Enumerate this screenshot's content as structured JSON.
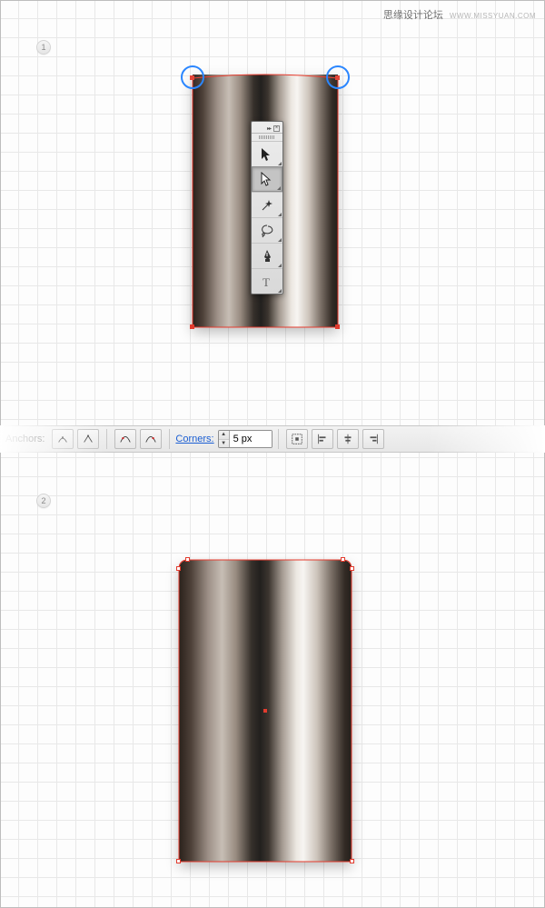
{
  "watermark": {
    "cn": "思缘设计论坛",
    "en": "WWW.MISSYUAN.COM"
  },
  "steps": {
    "s1": "1",
    "s2": "2"
  },
  "toolpanel": {
    "collapse": "▸▸",
    "close": "×",
    "tools": [
      {
        "name": "selection-tool-icon"
      },
      {
        "name": "direct-selection-tool-icon"
      },
      {
        "name": "magic-wand-tool-icon"
      },
      {
        "name": "lasso-tool-icon"
      },
      {
        "name": "pen-tool-icon"
      },
      {
        "name": "type-tool-icon"
      }
    ]
  },
  "optionsbar": {
    "anchors_label": "Anchors:",
    "corners_label": "Corners:",
    "corners_value": "5 px"
  }
}
